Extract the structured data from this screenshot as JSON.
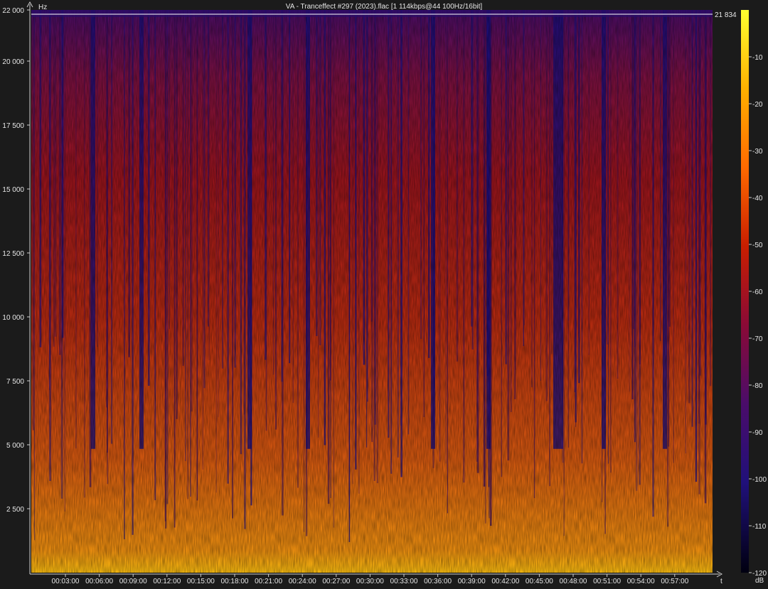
{
  "title": "VA - Tranceffect #297 (2023).flac [1 114kbps@44 100Hz/16bit]",
  "chart_data": {
    "type": "heatmap",
    "title": "VA - Tranceffect #297 (2023).flac [1 114kbps@44 100Hz/16bit]",
    "ylabel": "Hz",
    "xlabel": "t",
    "ylim": [
      0,
      22000
    ],
    "y_ticks": [
      {
        "value": 2500,
        "label": "2 500"
      },
      {
        "value": 5000,
        "label": "5 000"
      },
      {
        "value": 7500,
        "label": "7 500"
      },
      {
        "value": 10000,
        "label": "10 000"
      },
      {
        "value": 12500,
        "label": "12 500"
      },
      {
        "value": 15000,
        "label": "15 000"
      },
      {
        "value": 17500,
        "label": "17 500"
      },
      {
        "value": 20000,
        "label": "20 000"
      },
      {
        "value": 22000,
        "label": "22 000"
      }
    ],
    "x_ticks": [
      "00:03:00",
      "00:06:00",
      "00:09:00",
      "00:12:00",
      "00:15:00",
      "00:18:00",
      "00:21:00",
      "00:24:00",
      "00:27:00",
      "00:30:00",
      "00:33:00",
      "00:36:00",
      "00:39:00",
      "00:42:00",
      "00:45:00",
      "00:48:00",
      "00:51:00",
      "00:54:00",
      "00:57:00"
    ],
    "cutoff_frequency": 21834,
    "cutoff_label": "21 834",
    "colorbar": {
      "label": "dB",
      "range": [
        -120,
        0
      ],
      "ticks": [
        {
          "value": -10,
          "label": "-10"
        },
        {
          "value": -20,
          "label": "-20"
        },
        {
          "value": -30,
          "label": "-30"
        },
        {
          "value": -40,
          "label": "-40"
        },
        {
          "value": -50,
          "label": "-50"
        },
        {
          "value": -60,
          "label": "-60"
        },
        {
          "value": -70,
          "label": "-70"
        },
        {
          "value": -80,
          "label": "-80"
        },
        {
          "value": -90,
          "label": "-90"
        },
        {
          "value": -100,
          "label": "-100"
        },
        {
          "value": -110,
          "label": "-110"
        },
        {
          "value": -120,
          "label": "-120"
        }
      ],
      "colors": [
        "#ffff30",
        "#ffb000",
        "#ff6a00",
        "#c81e00",
        "#8a0a36",
        "#4a0c6a",
        "#20107a",
        "#000010"
      ]
    }
  }
}
